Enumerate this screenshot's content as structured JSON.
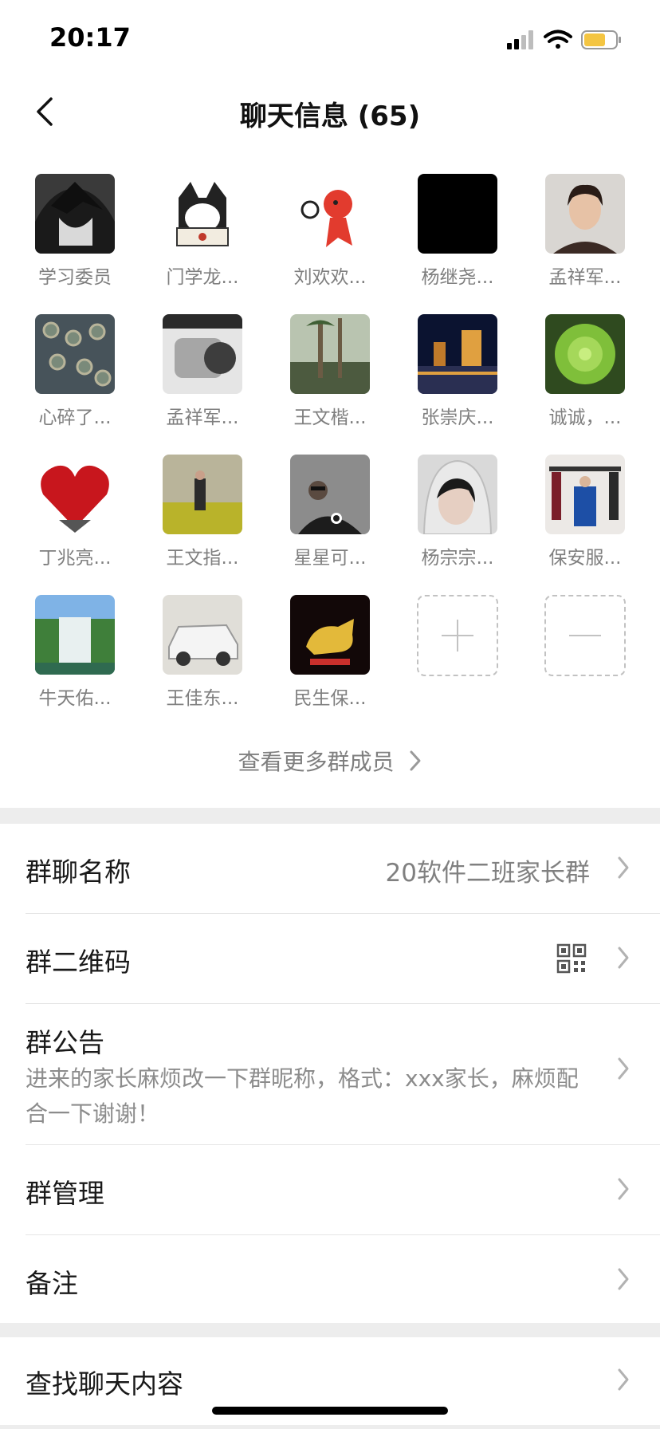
{
  "status_bar": {
    "time": "20:17",
    "icons": [
      "signal-icon",
      "wifi-icon",
      "battery-icon"
    ]
  },
  "nav": {
    "title": "聊天信息 (65)",
    "back_icon": "chevron-left-icon"
  },
  "members": [
    {
      "name": "学习委员"
    },
    {
      "name": "门学龙..."
    },
    {
      "name": "刘欢欢..."
    },
    {
      "name": "杨继尧..."
    },
    {
      "name": "孟祥军..."
    },
    {
      "name": "心碎了..."
    },
    {
      "name": "孟祥军..."
    },
    {
      "name": "王文楷..."
    },
    {
      "name": "张崇庆..."
    },
    {
      "name": "诚诚，..."
    },
    {
      "name": "丁兆亮..."
    },
    {
      "name": "王文指..."
    },
    {
      "name": "星星可..."
    },
    {
      "name": "杨宗宗..."
    },
    {
      "name": "保安服..."
    },
    {
      "name": "牛天佑..."
    },
    {
      "name": "王佳东..."
    },
    {
      "name": "民生保..."
    }
  ],
  "actions": {
    "add_icon": "plus-icon",
    "remove_icon": "minus-icon"
  },
  "more_members": "查看更多群成员",
  "settings": {
    "group_name_label": "群聊名称",
    "group_name_value": "20软件二班家长群",
    "qr_label": "群二维码",
    "notice_label": "群公告",
    "notice_text": "进来的家长麻烦改一下群昵称，格式：xxx家长，麻烦配合一下谢谢！",
    "manage_label": "群管理",
    "remark_label": "备注",
    "search_label": "查找聊天内容"
  },
  "colors": {
    "accent_battery": "#f4c542",
    "page_bg": "#ededed"
  }
}
